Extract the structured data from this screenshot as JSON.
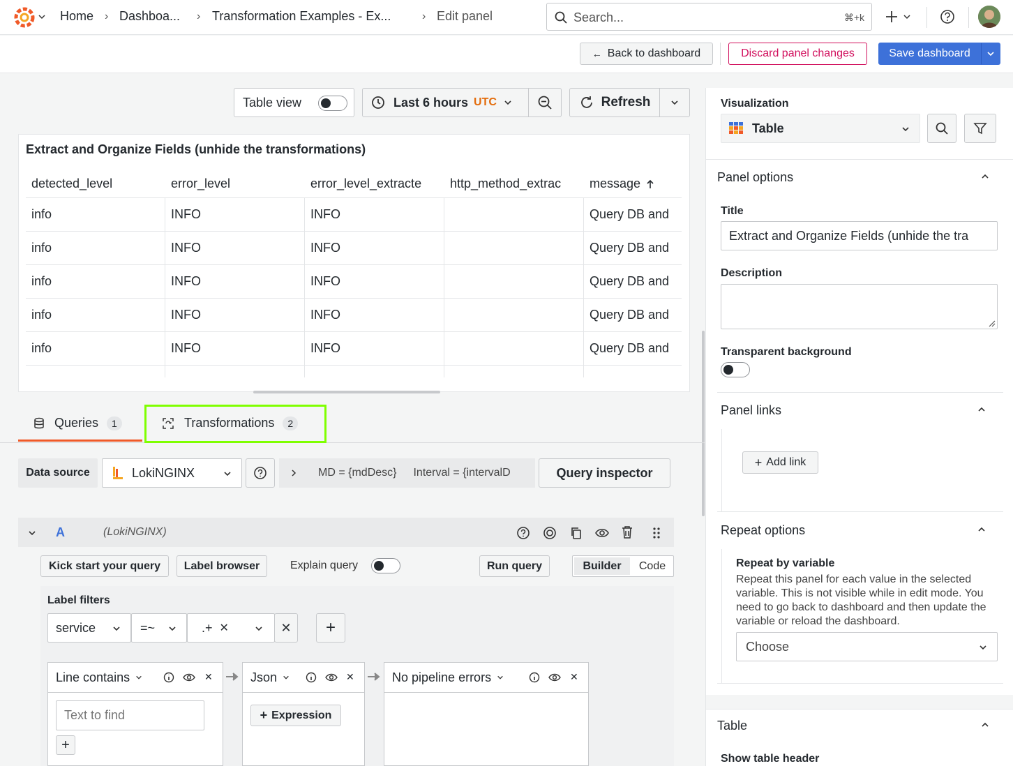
{
  "nav": {
    "home": "Home",
    "dashboards": "Dashboa...",
    "dashboard": "Transformation Examples - Ex...",
    "current": "Edit panel",
    "search_placeholder": "Search...",
    "search_shortcut": "⌘+k"
  },
  "actions": {
    "back": "Back to dashboard",
    "discard": "Discard panel changes",
    "save": "Save dashboard"
  },
  "panel_toolbar": {
    "table_view": "Table view",
    "time_range": "Last 6 hours",
    "timezone": "UTC",
    "refresh": "Refresh"
  },
  "panel": {
    "title": "Extract and Organize Fields (unhide the transformations)",
    "columns": [
      "detected_level",
      "error_level",
      "error_level_extracte",
      "http_method_extrac",
      "message"
    ],
    "rows": [
      [
        "info",
        "INFO",
        "INFO",
        "",
        "Query DB and"
      ],
      [
        "info",
        "INFO",
        "INFO",
        "",
        "Query DB and"
      ],
      [
        "info",
        "INFO",
        "INFO",
        "",
        "Query DB and"
      ],
      [
        "info",
        "INFO",
        "INFO",
        "",
        "Query DB and"
      ],
      [
        "info",
        "INFO",
        "INFO",
        "",
        "Query DB and"
      ]
    ]
  },
  "tabs": {
    "queries": {
      "label": "Queries",
      "count": "1"
    },
    "transformations": {
      "label": "Transformations",
      "count": "2"
    }
  },
  "query_bar": {
    "data_source_label": "Data source",
    "data_source": "LokiNGINX",
    "md": "MD = {mdDesc}",
    "interval": "Interval = {intervalD",
    "inspector": "Query inspector"
  },
  "query": {
    "ref": "A",
    "ds": "(LokiNGINX)",
    "kick_start": "Kick start your query",
    "label_browser": "Label browser",
    "explain": "Explain query",
    "run": "Run query",
    "builder": "Builder",
    "code": "Code",
    "label_filters": "Label filters",
    "filter_label": "service",
    "filter_op": "=~",
    "filter_value": ".+",
    "ops": [
      {
        "name": "Line contains",
        "placeholder": "Text to find"
      },
      {
        "name": "Json",
        "add": "Expression"
      },
      {
        "name": "No pipeline errors"
      }
    ]
  },
  "options": {
    "visualization_label": "Visualization",
    "visualization": "Table",
    "panel_options": "Panel options",
    "title_label": "Title",
    "title_value": "Extract and Organize Fields (unhide the tra",
    "description_label": "Description",
    "transparent_label": "Transparent background",
    "panel_links": "Panel links",
    "add_link": "Add link",
    "repeat_options": "Repeat options",
    "repeat_by_label": "Repeat by variable",
    "repeat_desc": "Repeat this panel for each value in the selected variable. This is not visible while in edit mode. You need to go back to dashboard and then update the variable or reload the dashboard.",
    "choose": "Choose",
    "table_section": "Table",
    "show_header": "Show table header"
  },
  "colors": {
    "primary": "#3d71d9",
    "danger": "#d10e5c",
    "highlight": "#7fff00",
    "utc": "#e36b0a",
    "tab_underline": "#f05a28"
  }
}
